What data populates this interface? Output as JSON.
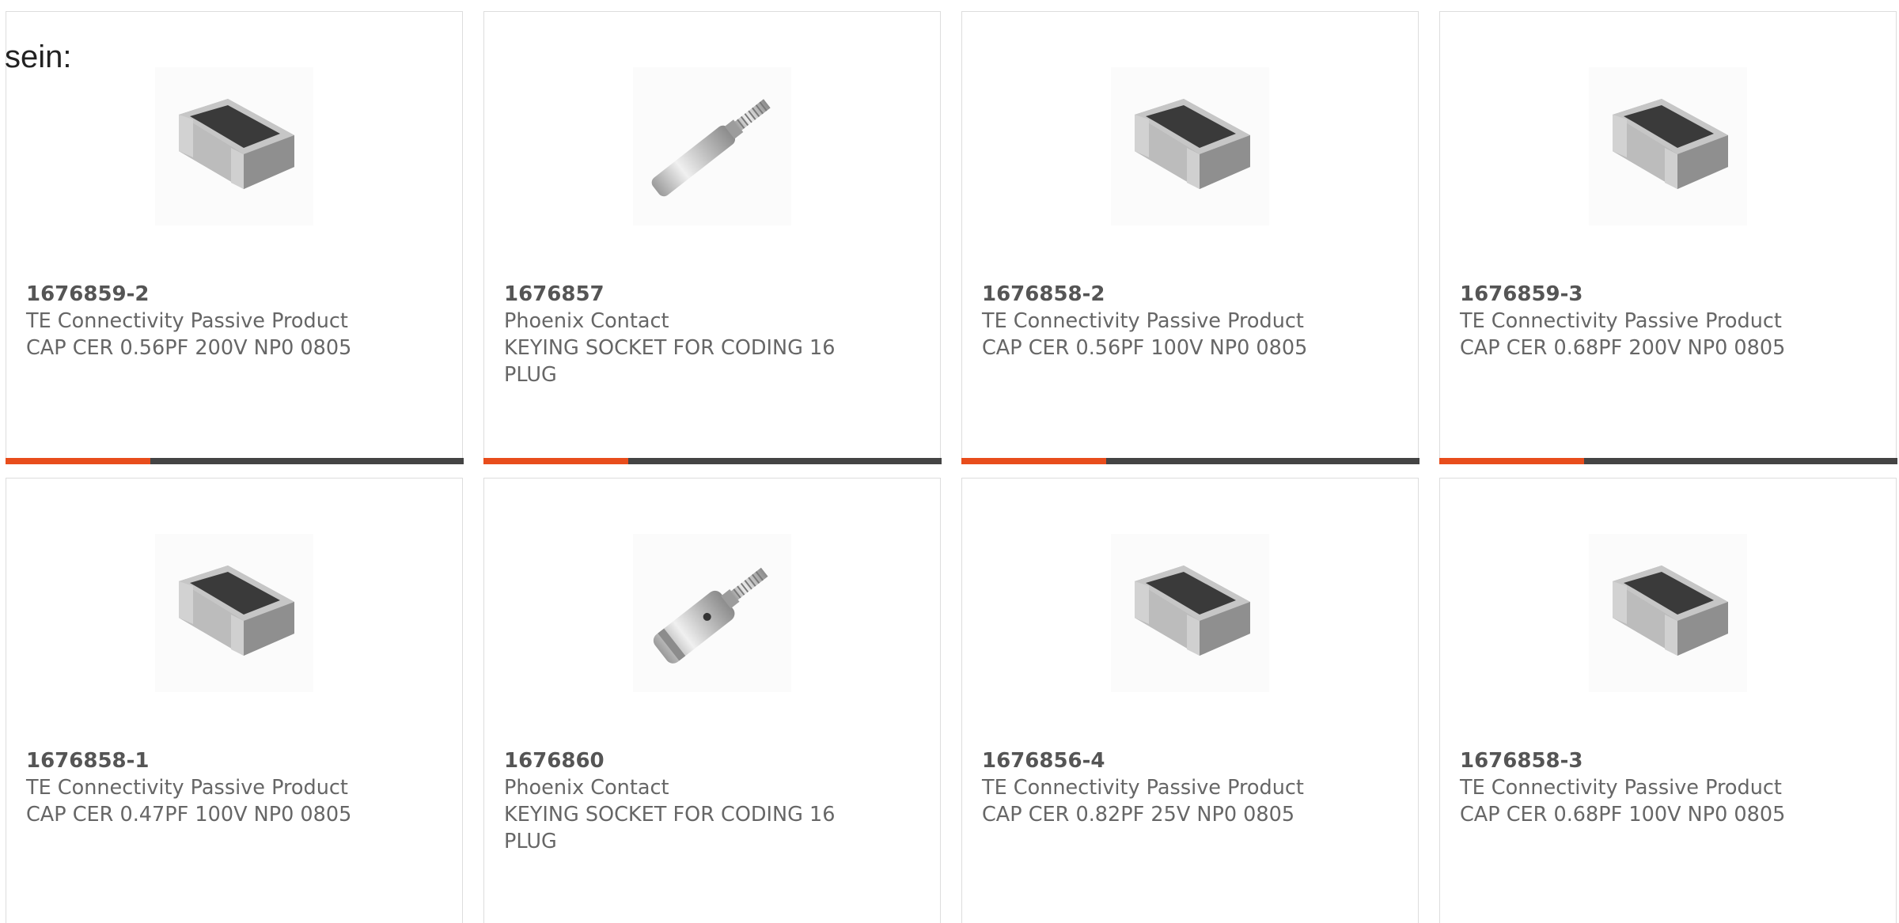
{
  "intro_text": "sein:",
  "colors": {
    "accent_orange": "#e84d1c",
    "accent_dark": "#444444",
    "card_border": "#dddddd",
    "text_gray": "#666666"
  },
  "products": [
    {
      "part_number": "1676859-2",
      "manufacturer": "TE Connectivity Passive Product",
      "description": "CAP CER 0.56PF 200V NP0 0805",
      "image": "ceramic-chip-capacitor"
    },
    {
      "part_number": "1676857",
      "manufacturer": "Phoenix Contact",
      "description": "KEYING SOCKET FOR CODING 16 PLUG",
      "image": "keying-pin-long"
    },
    {
      "part_number": "1676858-2",
      "manufacturer": "TE Connectivity Passive Product",
      "description": "CAP CER 0.56PF 100V NP0 0805",
      "image": "ceramic-chip-capacitor"
    },
    {
      "part_number": "1676859-3",
      "manufacturer": "TE Connectivity Passive Product",
      "description": "CAP CER 0.68PF 200V NP0 0805",
      "image": "ceramic-chip-capacitor"
    },
    {
      "part_number": "1676858-1",
      "manufacturer": "TE Connectivity Passive Product",
      "description": "CAP CER 0.47PF 100V NP0 0805",
      "image": "ceramic-chip-capacitor"
    },
    {
      "part_number": "1676860",
      "manufacturer": "Phoenix Contact",
      "description": "KEYING SOCKET FOR CODING 16 PLUG",
      "image": "keying-pin-short"
    },
    {
      "part_number": "1676856-4",
      "manufacturer": "TE Connectivity Passive Product",
      "description": "CAP CER 0.82PF 25V NP0 0805",
      "image": "ceramic-chip-capacitor"
    },
    {
      "part_number": "1676858-3",
      "manufacturer": "TE Connectivity Passive Product",
      "description": "CAP CER 0.68PF 100V NP0 0805",
      "image": "ceramic-chip-capacitor"
    }
  ]
}
